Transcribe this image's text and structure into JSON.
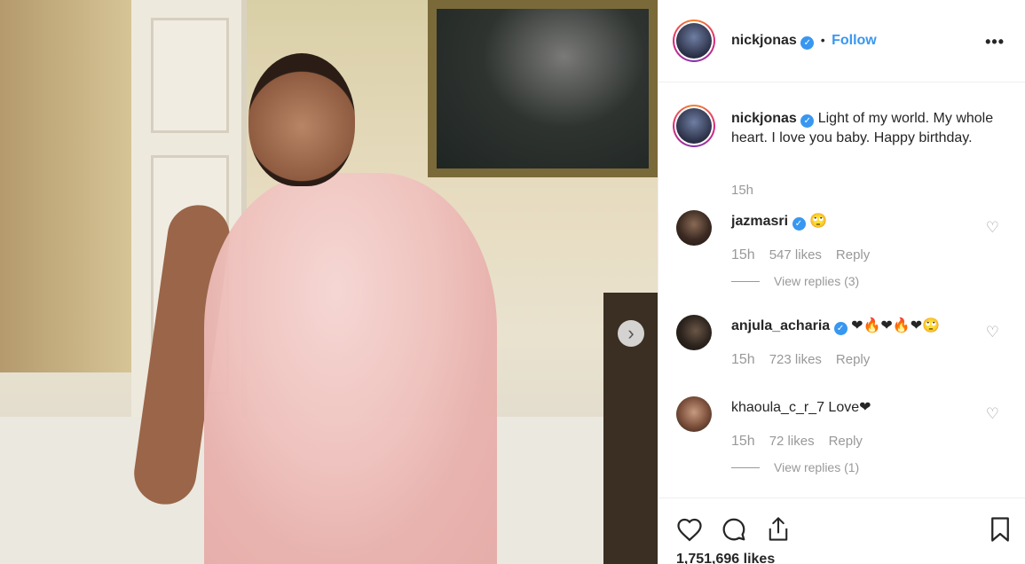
{
  "post": {
    "username": "nickjonas",
    "follow_label": "Follow",
    "separator": "•",
    "more_label": "•••",
    "caption": "Light of my world. My whole heart. I love you baby. Happy birthday.",
    "caption_time": "15h",
    "likes": "1,751,696 likes"
  },
  "comments": [
    {
      "username": "jazmasri",
      "verified": true,
      "text": "🙄",
      "time": "15h",
      "likes": "547 likes",
      "reply_label": "Reply",
      "view_replies": "View replies (3)"
    },
    {
      "username": "anjula_acharia",
      "verified": true,
      "text": "❤🔥❤🔥❤🙄",
      "time": "15h",
      "likes": "723 likes",
      "reply_label": "Reply",
      "view_replies": ""
    },
    {
      "username": "khaoula_c_r_7",
      "verified": false,
      "text": "Love❤",
      "time": "15h",
      "likes": "72 likes",
      "reply_label": "Reply",
      "view_replies": "View replies (1)"
    }
  ],
  "icons": {
    "verified": "✓",
    "like": "heart-icon",
    "comment": "comment-icon",
    "share": "share-icon",
    "save": "bookmark-icon",
    "next": "chevron-right-icon"
  },
  "colors": {
    "accent": "#3897f0",
    "muted": "#999999",
    "text": "#262626"
  }
}
